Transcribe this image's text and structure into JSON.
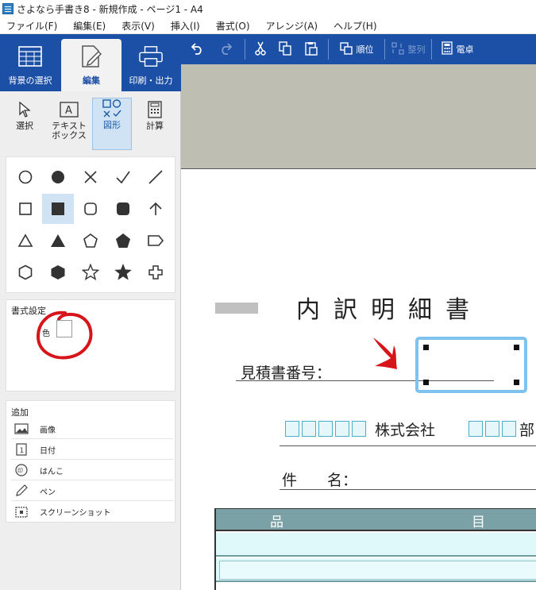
{
  "window": {
    "title": "さよなら手書き8 - 新規作成 - ページ1 - A4"
  },
  "menu": [
    "ファイル(F)",
    "編集(E)",
    "表示(V)",
    "挿入(I)",
    "書式(O)",
    "アレンジ(A)",
    "ヘルプ(H)"
  ],
  "tabs": [
    {
      "label": "背景の選択",
      "icon": "background-icon"
    },
    {
      "label": "編集",
      "icon": "edit-icon",
      "active": true
    },
    {
      "label": "印刷・出力",
      "icon": "printer-icon"
    }
  ],
  "tools": [
    {
      "label": "選択",
      "icon": "pointer-icon"
    },
    {
      "label": "テキスト\nボックス",
      "icon": "textbox-icon"
    },
    {
      "label": "図形",
      "icon": "shapes-icon",
      "active": true
    },
    {
      "label": "計算",
      "icon": "calculator-icon"
    }
  ],
  "shapes": [
    [
      "circle-outline",
      "circle-filled",
      "cross",
      "check",
      "line"
    ],
    [
      "square-outline",
      "square-filled",
      "rounded-square-outline",
      "rounded-square-filled",
      "arrow-up"
    ],
    [
      "triangle-outline",
      "triangle-filled",
      "pentagon-outline",
      "pentagon-filled",
      "tag"
    ],
    [
      "hexagon-outline",
      "hexagon-filled",
      "star-outline",
      "star-filled",
      "plus-outline"
    ]
  ],
  "format": {
    "title": "書式設定",
    "color_label": "色"
  },
  "add": {
    "title": "追加",
    "items": [
      {
        "label": "画像",
        "icon": "image-icon"
      },
      {
        "label": "日付",
        "icon": "date-icon"
      },
      {
        "label": "はんこ",
        "icon": "stamp-icon"
      },
      {
        "label": "ペン",
        "icon": "pen-icon"
      },
      {
        "label": "スクリーンショット",
        "icon": "screenshot-icon"
      }
    ]
  },
  "toolbar": {
    "order_label": "順位",
    "align_label": "整列",
    "calculator_label": "電卓"
  },
  "document": {
    "title": "内訳明細書",
    "estimate_label": "見積書番号：",
    "company_suffix": "株式会社",
    "department_partial": "部",
    "subject_label": "件　　名：",
    "table_headers": [
      "品",
      "目"
    ]
  },
  "colors": {
    "accent": "#1c4fa6",
    "selection_highlight": "#7ec3ef",
    "annotation_red": "#d8141b",
    "table_header": "#7aa1a5",
    "page_band": "#bfbeb2"
  }
}
